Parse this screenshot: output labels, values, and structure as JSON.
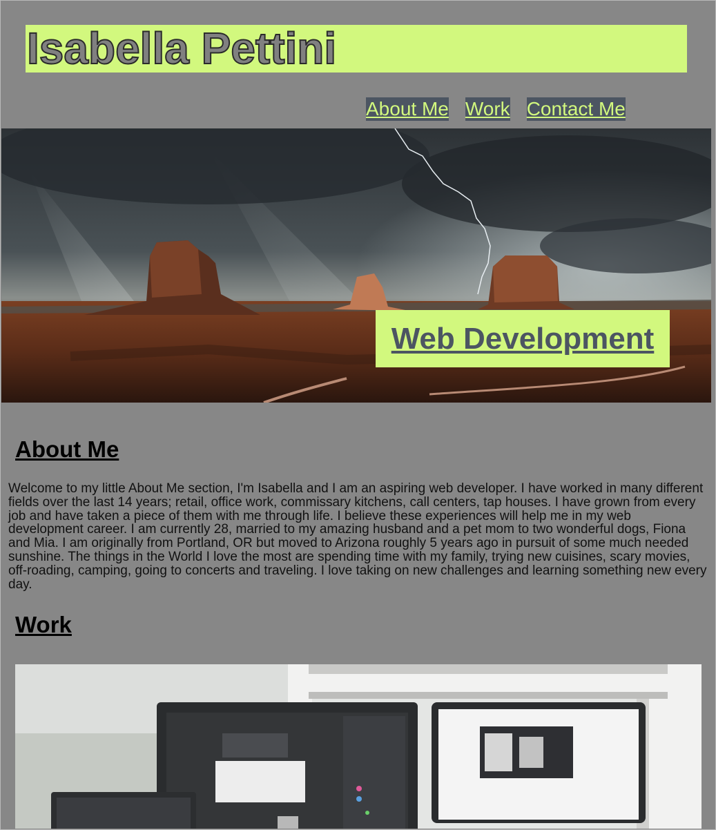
{
  "header": {
    "title": "Isabella Pettini"
  },
  "nav": {
    "items": [
      {
        "label": "About Me"
      },
      {
        "label": "Work"
      },
      {
        "label": "Contact Me"
      }
    ]
  },
  "hero": {
    "image": "desert-storm-monument-valley-photo",
    "badge_label": "Web Development"
  },
  "about": {
    "heading": "About Me",
    "body": "Welcome to my little About Me section, I'm Isabella and I am an aspiring web developer. I have worked in many different fields over the last 14 years; retail, office work, commissary kitchens, call centers, tap houses. I have grown from every job and have taken a piece of them with me through life. I believe these experiences will help me in my web development career. I am currently 28, married to my amazing husband and a pet mom to two wonderful dogs, Fiona and Mia. I am originally from Portland, OR but moved to Arizona roughly 5 years ago in pursuit of some much needed sunshine. The things in the World I love the most are spending time with my family, trying new cuisines, scary movies, off-roading, camping, going to concerts and traveling. I love taking on new challenges and learning something new every day."
  },
  "work": {
    "heading": "Work",
    "image": "desk-monitors-photo"
  },
  "colors": {
    "background": "#878787",
    "accent": "#d2f87e",
    "nav_bg": "#4c5562",
    "text": "#111111"
  }
}
